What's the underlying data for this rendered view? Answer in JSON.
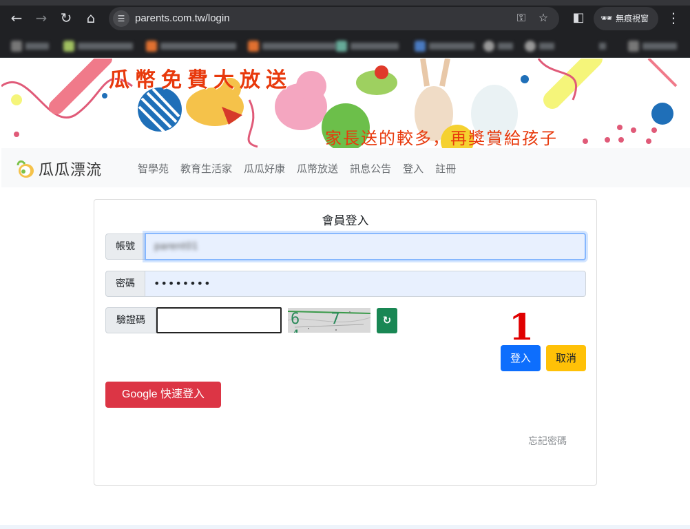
{
  "browser": {
    "url": "parents.com.tw/login",
    "incognito_label": "無痕視窗",
    "bookmarks": [
      "",
      "",
      "",
      "",
      "",
      "",
      "",
      "",
      ""
    ]
  },
  "banner": {
    "title": "瓜幣免費大放送",
    "subtitle": "家長送的較多，再獎賞給孩子"
  },
  "site": {
    "logo_text": "瓜瓜漂流",
    "nav": [
      "智學苑",
      "教育生活家",
      "瓜瓜好康",
      "瓜幣放送",
      "訊息公告",
      "登入",
      "註冊"
    ]
  },
  "login": {
    "title": "會員登入",
    "account_label": "帳號",
    "account_value": "parent01",
    "password_label": "密碼",
    "password_value": "••••••••",
    "captcha_label": "驗證碼",
    "captcha_value": "",
    "captcha_text": "6 7 4",
    "refresh_glyph": "↻",
    "annotation": "1",
    "login_button": "登入",
    "cancel_button": "取消",
    "google_button": "Google 快速登入",
    "forgot_link": "忘記密碼"
  },
  "colors": {
    "primary": "#0d6efd",
    "warning": "#ffc107",
    "danger": "#dc3545",
    "success": "#198754",
    "banner_text": "#e8390c"
  }
}
